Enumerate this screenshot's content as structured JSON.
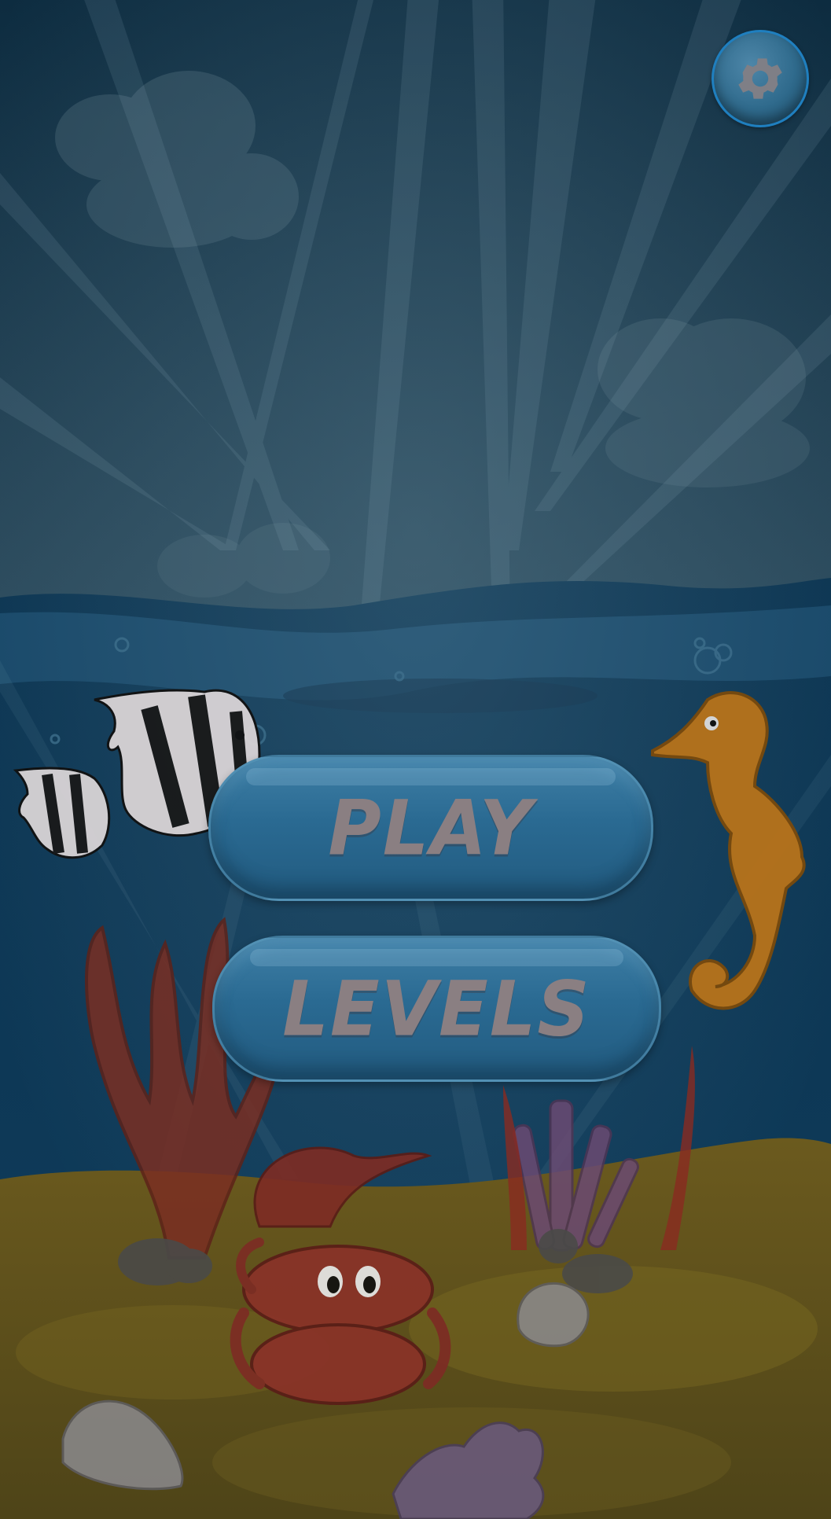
{
  "buttons": {
    "play_label": "PLAY",
    "levels_label": "LEVELS"
  },
  "icons": {
    "settings": "gear-icon"
  },
  "colors": {
    "sky_top": "#0f2f44",
    "sky_bottom": "#2a4a5e",
    "water": "#0e3a5a",
    "sand": "#5a5220",
    "button": "#2a6a92",
    "button_text": "#8a7f82",
    "settings_ring": "#1f7fbf"
  }
}
